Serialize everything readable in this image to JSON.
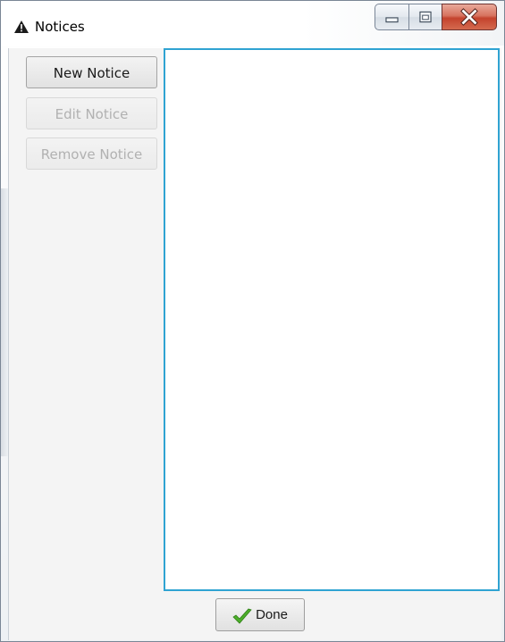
{
  "window": {
    "title": "Notices",
    "title_icon": "warning-icon",
    "caption_buttons": [
      "minimize-icon",
      "maximize-icon",
      "close-icon"
    ]
  },
  "sidebar": {
    "new_notice": "New Notice",
    "edit_notice": "Edit Notice",
    "remove_notice": "Remove Notice"
  },
  "notices_list": {
    "items": []
  },
  "footer": {
    "done_label": "Done",
    "done_icon": "checkmark-icon"
  },
  "colors": {
    "list_border": "#2fa3d2",
    "close_button": "#c4432d",
    "checkmark": "#4caf2a",
    "disabled_text": "#b1b1b1"
  }
}
